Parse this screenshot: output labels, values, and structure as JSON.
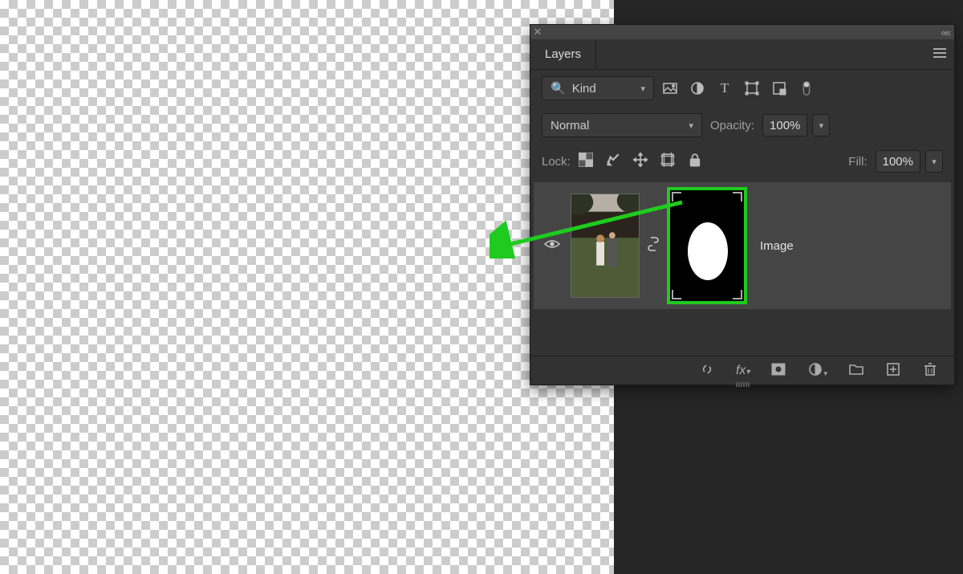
{
  "panel": {
    "title": "Layers",
    "filter": {
      "kind_label": "Kind",
      "search_glyph": "⌕",
      "icons": [
        "image-icon",
        "adjustment-icon",
        "type-icon",
        "shape-icon",
        "smartobject-icon",
        "artboard-icon"
      ]
    },
    "blend": {
      "mode": "Normal",
      "opacity_label": "Opacity:",
      "opacity_value": "100%"
    },
    "lock": {
      "label": "Lock:",
      "fill_label": "Fill:",
      "fill_value": "100%"
    },
    "layer": {
      "name": "Image",
      "visible": true,
      "has_mask": true
    },
    "footer_icons": [
      "link-icon",
      "fx-icon",
      "mask-icon",
      "adjustment-layer-icon",
      "group-icon",
      "new-layer-icon",
      "trash-icon"
    ]
  },
  "annotation": {
    "highlight_color": "#1ecb1e",
    "arrow_from": "mask-thumbnail",
    "arrow_to": "canvas-image"
  }
}
